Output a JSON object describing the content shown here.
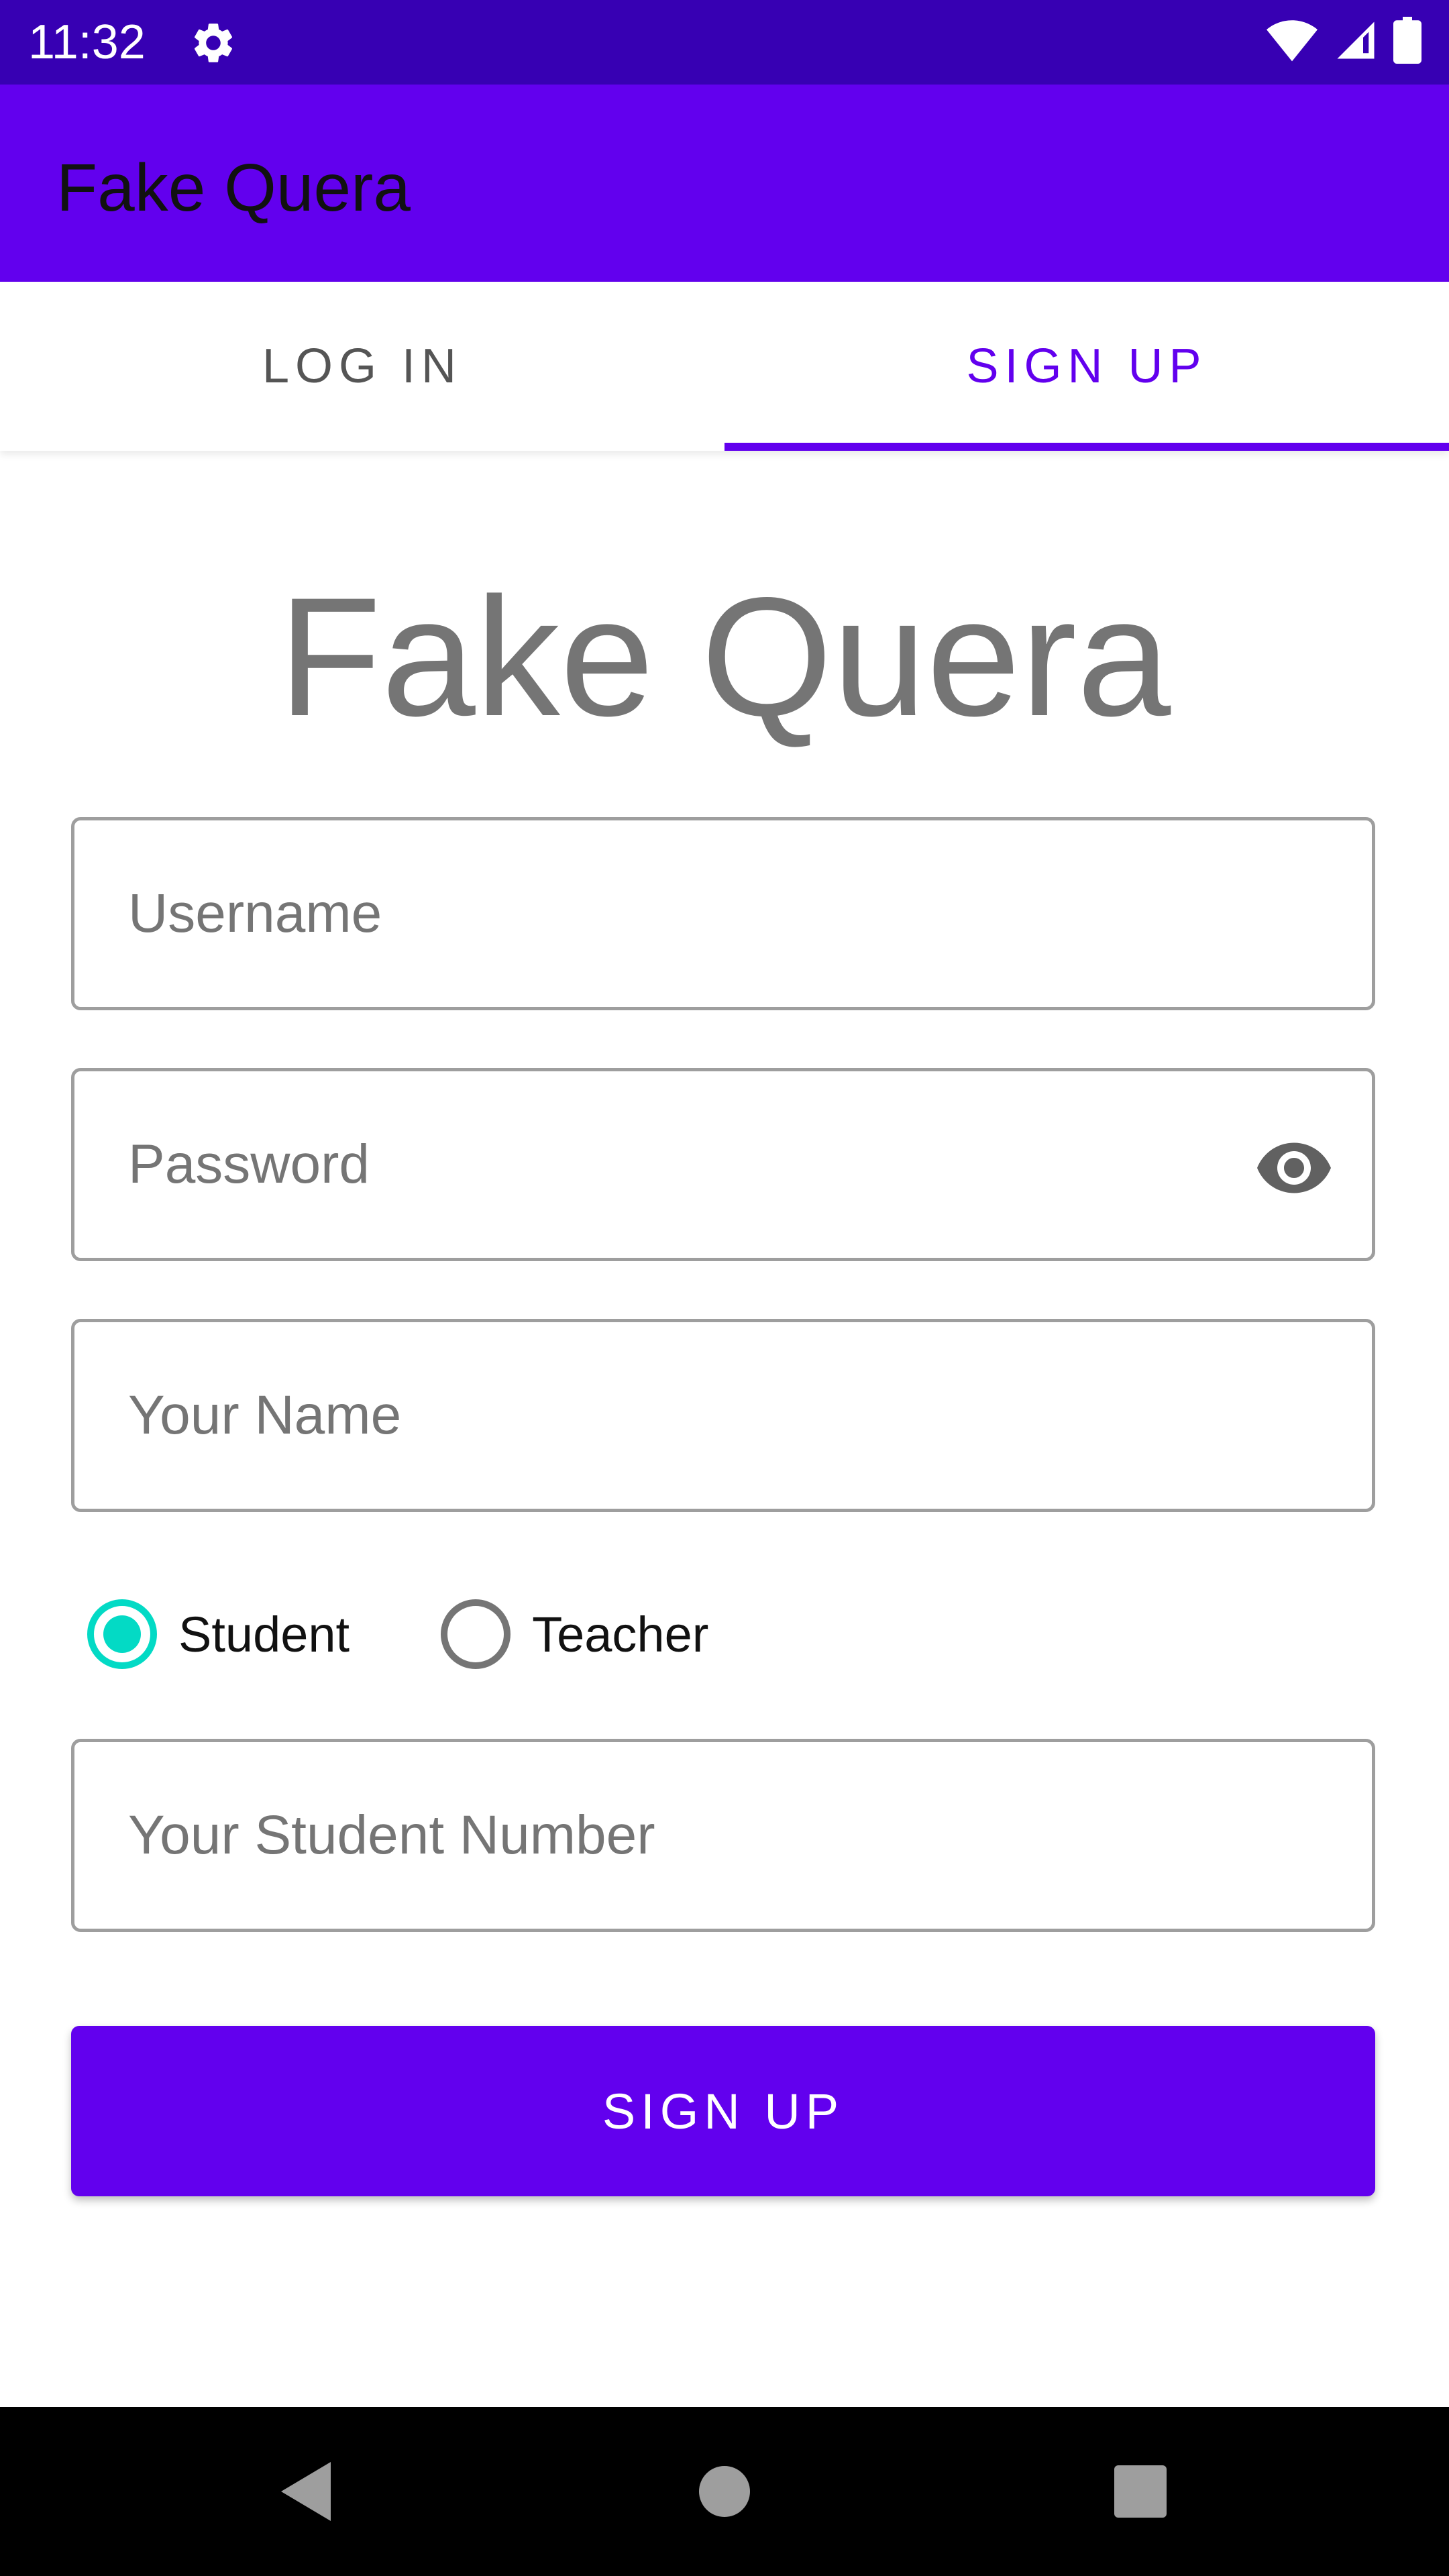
{
  "status_bar": {
    "time": "11:32",
    "icons": [
      "settings-icon",
      "wifi-icon",
      "cell-signal-icon",
      "battery-icon"
    ]
  },
  "app_bar": {
    "title": "Fake Quera"
  },
  "tabs": [
    {
      "label": "LOG IN",
      "selected": false
    },
    {
      "label": "SIGN UP",
      "selected": true
    }
  ],
  "form": {
    "heading": "Fake Quera",
    "username": {
      "value": "",
      "placeholder": "Username"
    },
    "password": {
      "value": "",
      "placeholder": "Password",
      "toggle_icon": "eye-icon"
    },
    "name": {
      "value": "",
      "placeholder": "Your Name"
    },
    "roles": [
      {
        "label": "Student",
        "checked": true
      },
      {
        "label": "Teacher",
        "checked": false
      }
    ],
    "student_number": {
      "value": "",
      "placeholder": "Your Student Number"
    },
    "submit_label": "SIGN UP"
  },
  "nav_bar": {
    "buttons": [
      "back-icon",
      "home-icon",
      "recents-icon"
    ]
  },
  "colors": {
    "status_bar": "#3700B3",
    "primary": "#6200EE",
    "accent": "#03DAC5",
    "heading_text": "#757575"
  }
}
